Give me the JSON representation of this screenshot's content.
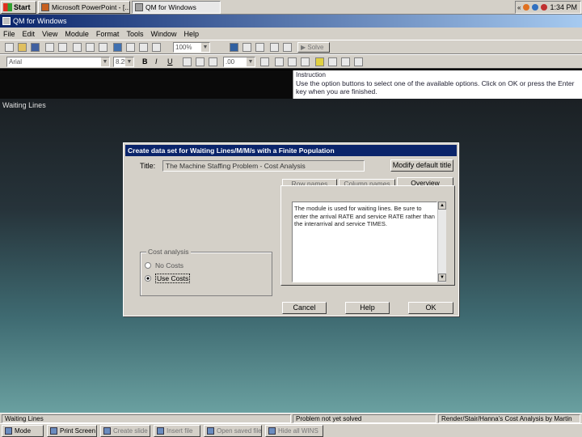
{
  "taskbar": {
    "start_label": "Start",
    "tasks": [
      {
        "label": "Microsoft PowerPoint - [...",
        "active": false
      },
      {
        "label": "QM for Windows",
        "active": true
      }
    ],
    "clock": "1:34 PM"
  },
  "window": {
    "title": "QM for Windows"
  },
  "menu": {
    "items": [
      "File",
      "Edit",
      "View",
      "Module",
      "Format",
      "Tools",
      "Window",
      "Help"
    ]
  },
  "toolbar": {
    "zoom_value": "100%",
    "solve_label": "Solve",
    "font_name": "Arial",
    "font_size": "8.25",
    "number_format": ".00"
  },
  "instruction": {
    "title": "Instruction",
    "text": "Use the option buttons to select one of the available options. Click on OK or press the Enter key when you are finished."
  },
  "main": {
    "label": "Waiting Lines"
  },
  "dialog": {
    "title": "Create data set for Waiting Lines/M/M/s with a Finite Population",
    "title_label": "Title:",
    "title_value": "The Machine Staffing Problem - Cost Analysis",
    "modify_default_button": "Modify default title",
    "tabs": [
      "Row names",
      "Column names",
      "Overview"
    ],
    "overview_text": "The module is used for waiting lines. Be sure to enter the arrival RATE and service RATE rather than the interarrival and service TIMES.",
    "cost_group_label": "Cost analysis",
    "options": [
      {
        "label": "No Costs",
        "selected": false
      },
      {
        "label": "Use Costs",
        "selected": true
      }
    ],
    "cancel_button": "Cancel",
    "help_button": "Help",
    "ok_button": "OK"
  },
  "statusbar": {
    "module": "Waiting Lines",
    "problem": "Problem not yet solved",
    "reference": "Render/Stair/Hanna's Cost Analysis by Martin"
  },
  "bottom_taskbar": {
    "tasks": [
      "Mode",
      "Print Screen",
      "Create slide",
      "Insert file",
      "Open saved file",
      "Hide all WINS"
    ]
  }
}
